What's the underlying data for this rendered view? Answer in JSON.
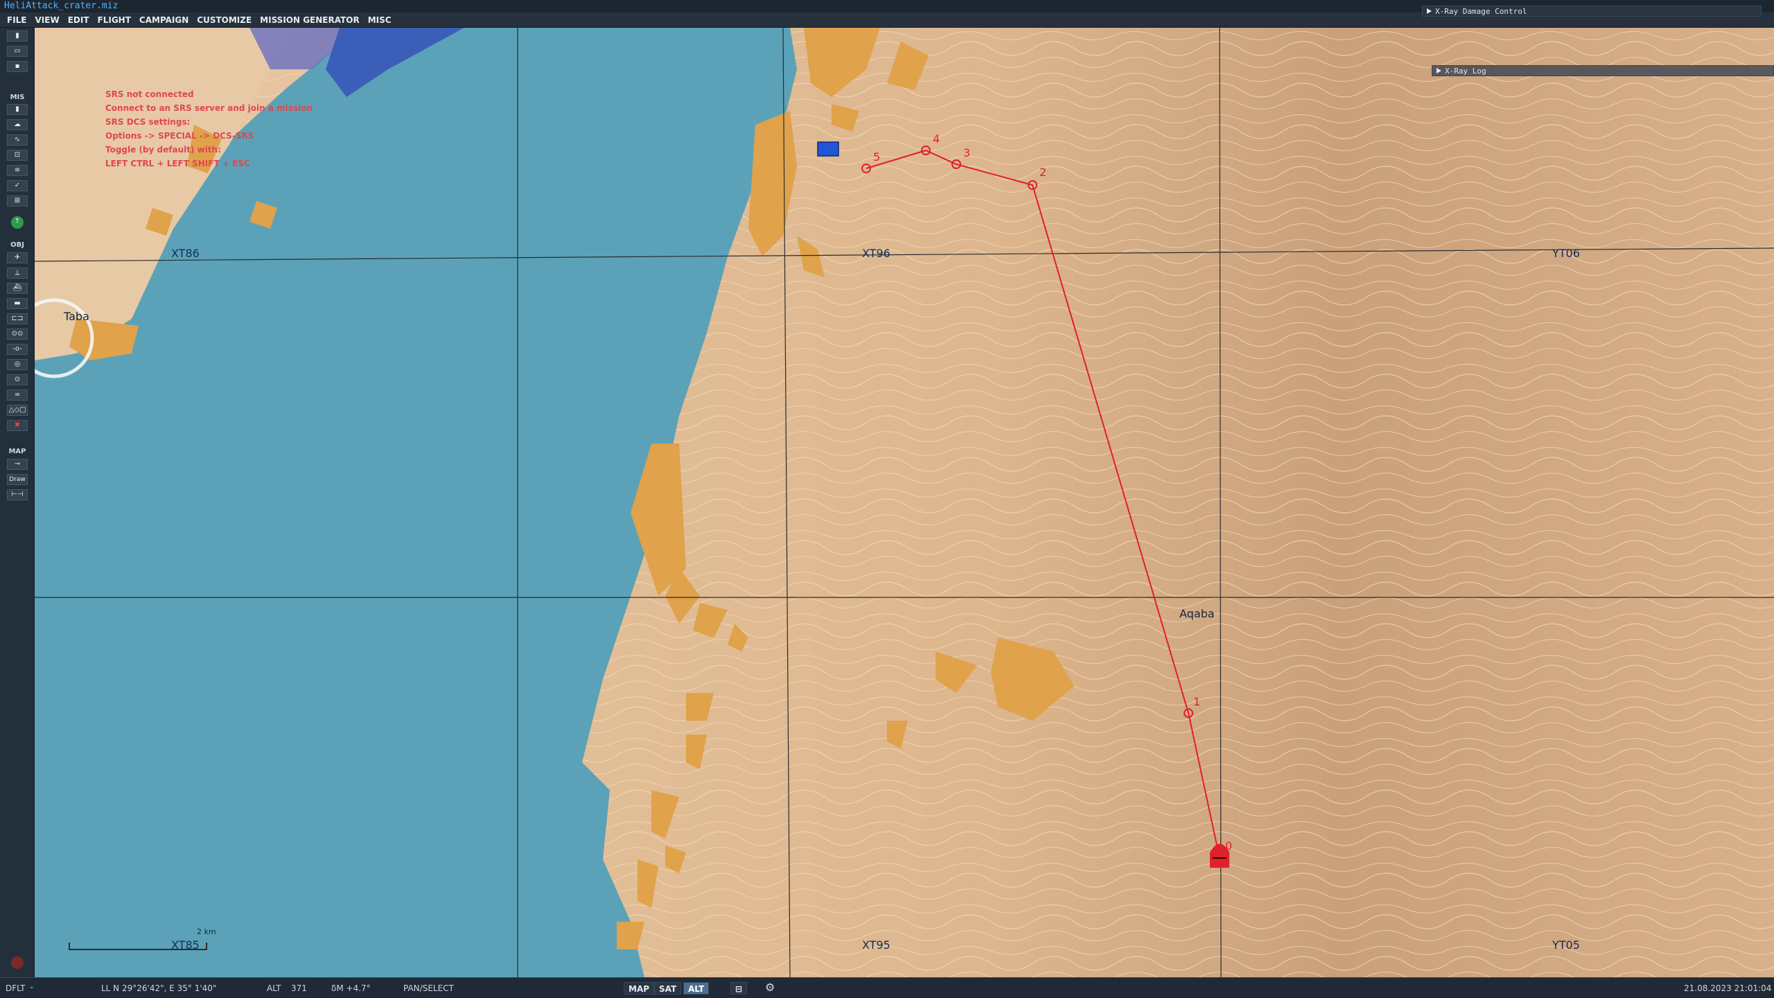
{
  "window": {
    "title": "HeliAttack_crater.miz"
  },
  "menu": [
    "FILE",
    "VIEW",
    "EDIT",
    "FLIGHT",
    "CAMPAIGN",
    "CUSTOMIZE",
    "MISSION GENERATOR",
    "MISC"
  ],
  "xray": {
    "damage_label": "X-Ray Damage Control",
    "log_label": "X-Ray Log"
  },
  "toolbar": {
    "sections": {
      "mis": "MIS",
      "obj": "OBJ",
      "map": "MAP"
    },
    "draw_label": "Draw"
  },
  "srs": {
    "lines": [
      "SRS not connected",
      "Connect to an SRS server and join a mission",
      "SRS DCS settings:",
      "Options -> SPECIAL -> DCS-SRS",
      "Toggle (by default) with:",
      "LEFT CTRL + LEFT SHIFT + ESC"
    ]
  },
  "map": {
    "grid_labels": [
      "XT86",
      "XT96",
      "YT06",
      "XT85",
      "XT95",
      "YT05"
    ],
    "places": [
      "Taba",
      "Aqaba"
    ],
    "waypoints": [
      "0",
      "1",
      "2",
      "3",
      "4",
      "5"
    ],
    "scale_label": "2 km",
    "colors": {
      "water": "#5ba2b8",
      "land": "#e8c9a5",
      "urban": "#e0a24a",
      "route": "#e0202a"
    }
  },
  "status": {
    "profile": "DFLT",
    "coords": "LL  N 29°26'42\", E 35° 1'40\"",
    "alt_label": "ALT",
    "alt_value": "371",
    "mag": "δM  +4.7°",
    "mode": "PAN/SELECT",
    "map_btn": "MAP",
    "sat_btn": "SAT",
    "alt_btn": "ALT",
    "datetime": "21.08.2023 21:01:04"
  }
}
